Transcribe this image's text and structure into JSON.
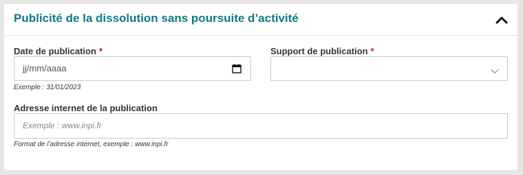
{
  "section": {
    "title": "Publicité de la dissolution sans poursuite d’activité",
    "collapse_icon": "chevron-up-icon"
  },
  "fields": {
    "date": {
      "label": "Date de publication",
      "required_mark": "*",
      "placeholder": "jj/mm/aaaa",
      "hint": "Exemple : 31/01/2023",
      "icon": "calendar-icon"
    },
    "support": {
      "label": "Support de publication",
      "required_mark": "*",
      "value": "",
      "icon": "chevron-down-icon"
    },
    "url": {
      "label": "Adresse internet de la publication",
      "placeholder": "Exemple : www.inpi.fr",
      "hint": "Format de l’adresse internet, exemple : www.inpi.fr"
    }
  },
  "colors": {
    "title": "#0c7b83",
    "required": "#c8102e",
    "page_background": "#e6e6e6"
  }
}
